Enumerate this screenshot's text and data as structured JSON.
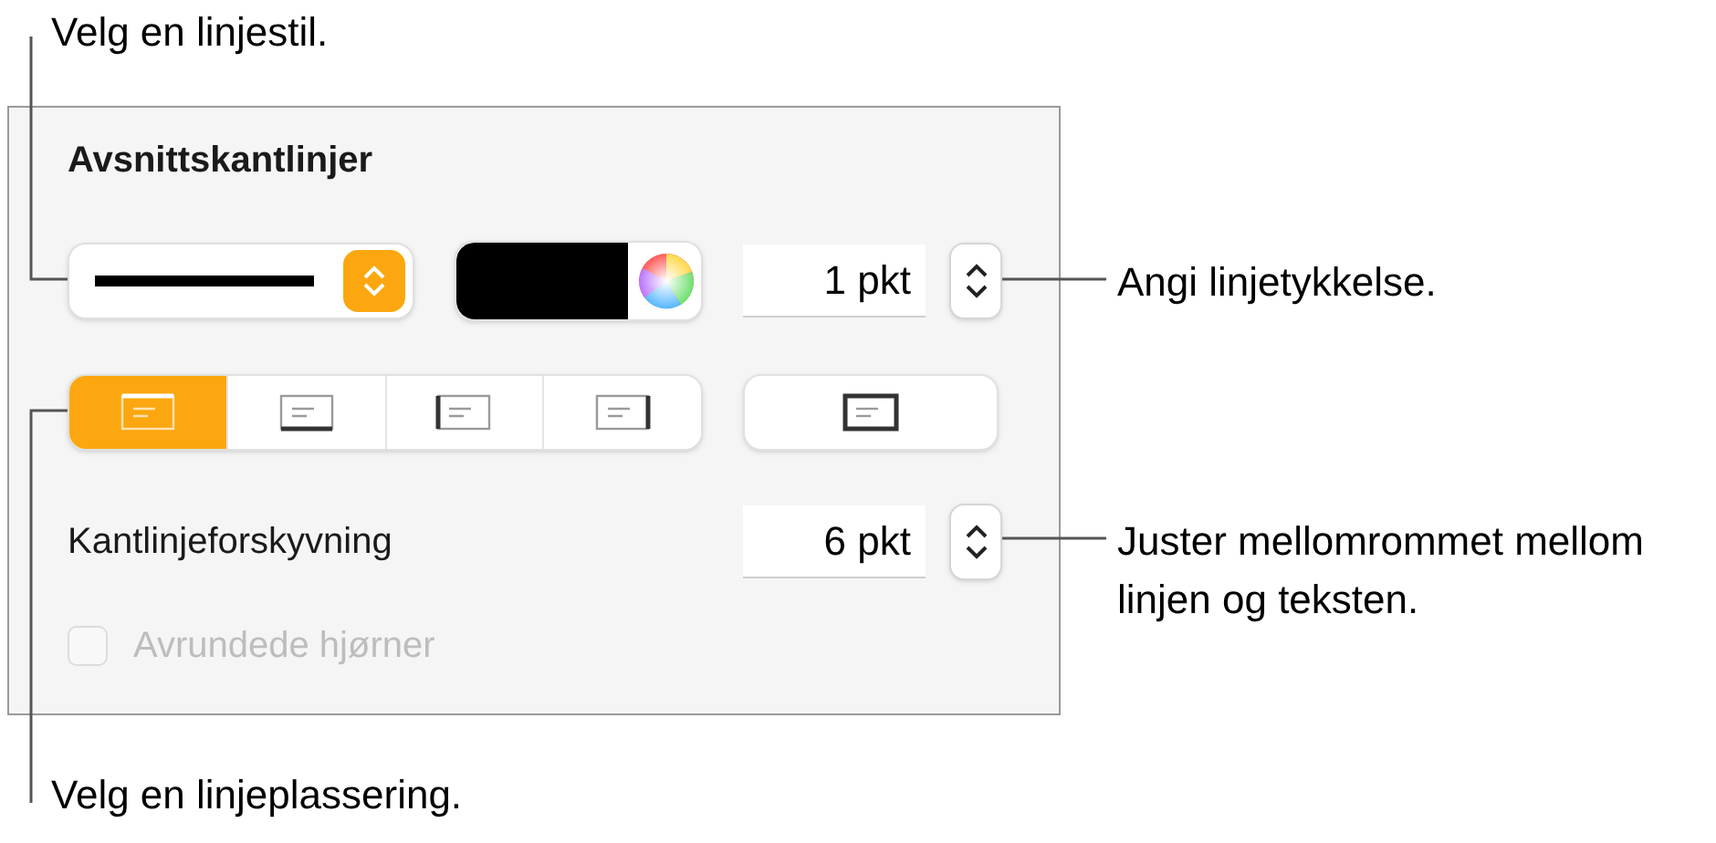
{
  "callouts": [
    {
      "kind": "left_top",
      "text": "Velg en linjestil."
    },
    {
      "kind": "right_top",
      "text": "Angi linjetykkelse."
    },
    {
      "kind": "right_bottom",
      "text": "Juster mellomrommet mellom linjen og teksten."
    },
    {
      "kind": "left_bottom",
      "text": "Velg en linjeplassering."
    }
  ],
  "panel": {
    "title": "Avsnittskantlinjer",
    "thickness": {
      "value": "1 pkt"
    },
    "placements": [
      {
        "kind": "top",
        "selected": true
      },
      {
        "kind": "bottom",
        "selected": false
      },
      {
        "kind": "left",
        "selected": false
      },
      {
        "kind": "right",
        "selected": false
      }
    ],
    "box_placement": {
      "kind": "all",
      "selected": false
    },
    "offset": {
      "label": "Kantlinjeforskyvning",
      "value": "6 pkt"
    },
    "rounded_corners": {
      "label": "Avrundede hjørner",
      "checked": false,
      "disabled": true
    }
  }
}
